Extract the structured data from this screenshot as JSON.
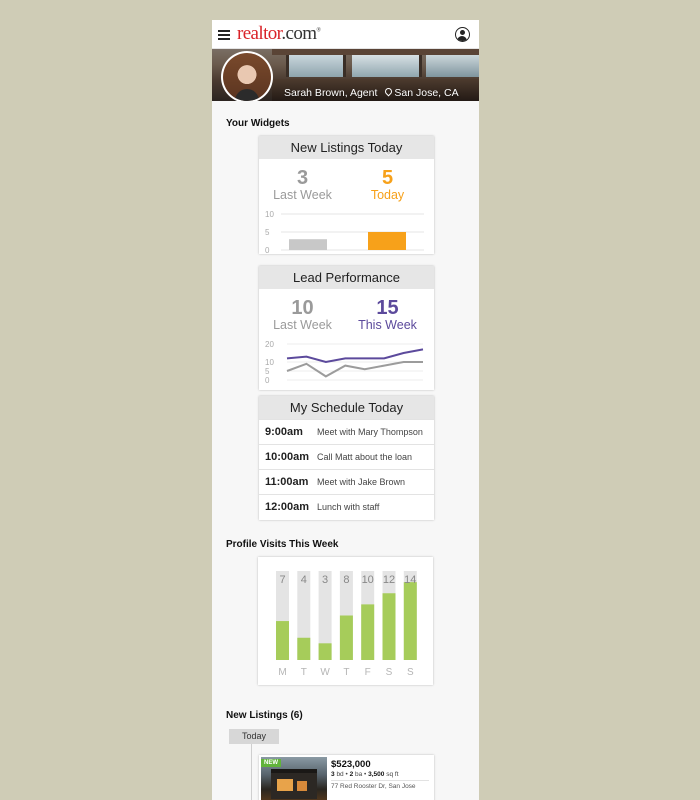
{
  "app": {
    "logo_red": "realtor",
    "logo_dark": ".com",
    "logo_mark": "®",
    "brand_color": "#d92228"
  },
  "agent": {
    "name": "Sarah Brown, Agent",
    "location": "San Jose, CA"
  },
  "widgets": {
    "section_title": "Your Widgets",
    "new_listings": {
      "title": "New Listings Today",
      "last_week_value": "3",
      "last_week_label": "Last Week",
      "today_value": "5",
      "today_label": "Today"
    },
    "lead_performance": {
      "title": "Lead Performance",
      "last_week_value": "10",
      "last_week_label": "Last Week",
      "this_week_value": "15",
      "this_week_label": "This Week"
    },
    "schedule": {
      "title": "My Schedule Today",
      "items": [
        {
          "time": "9:00am",
          "desc": "Meet with Mary Thompson"
        },
        {
          "time": "10:00am",
          "desc": "Call Matt about the loan"
        },
        {
          "time": "11:00am",
          "desc": "Meet with Jake Brown"
        },
        {
          "time": "12:00am",
          "desc": "Lunch with staff"
        }
      ]
    }
  },
  "profile_visits": {
    "section_title": "Profile Visits This Week"
  },
  "new_listings_section": {
    "title": "New Listings (6)",
    "tab_label": "Today",
    "listing": {
      "badge": "NEW",
      "price": "$523,000",
      "beds": "3",
      "beds_unit": "bd",
      "baths": "2",
      "baths_unit": "ba",
      "sqft": "3,500",
      "sqft_unit": "sq ft",
      "address": "77 Red Rooster Dr, San Jose"
    }
  },
  "colors": {
    "orange": "#f7a11a",
    "purple": "#5c4a9c",
    "green": "#a6cc5a",
    "grey_bar": "#c8c8c8"
  },
  "chart_data": [
    {
      "type": "bar",
      "title": "New Listings Today",
      "categories": [
        "Last Week",
        "Today"
      ],
      "values": [
        3,
        5
      ],
      "ylim": [
        0,
        10
      ],
      "yticks": [
        0,
        5,
        10
      ]
    },
    {
      "type": "line",
      "title": "Lead Performance",
      "x": [
        1,
        2,
        3,
        4,
        5,
        6,
        7,
        8
      ],
      "series": [
        {
          "name": "This Week",
          "values": [
            12,
            13,
            10,
            12,
            12,
            12,
            15,
            17
          ]
        },
        {
          "name": "Last Week",
          "values": [
            5,
            9,
            2,
            8,
            6,
            8,
            10,
            10
          ]
        }
      ],
      "ylim": [
        0,
        20
      ],
      "yticks": [
        0,
        5,
        10,
        20
      ]
    },
    {
      "type": "bar",
      "title": "Profile Visits This Week",
      "categories": [
        "M",
        "T",
        "W",
        "T",
        "F",
        "S",
        "S"
      ],
      "values": [
        7,
        4,
        3,
        8,
        10,
        12,
        14
      ],
      "ylim": [
        0,
        16
      ]
    }
  ]
}
